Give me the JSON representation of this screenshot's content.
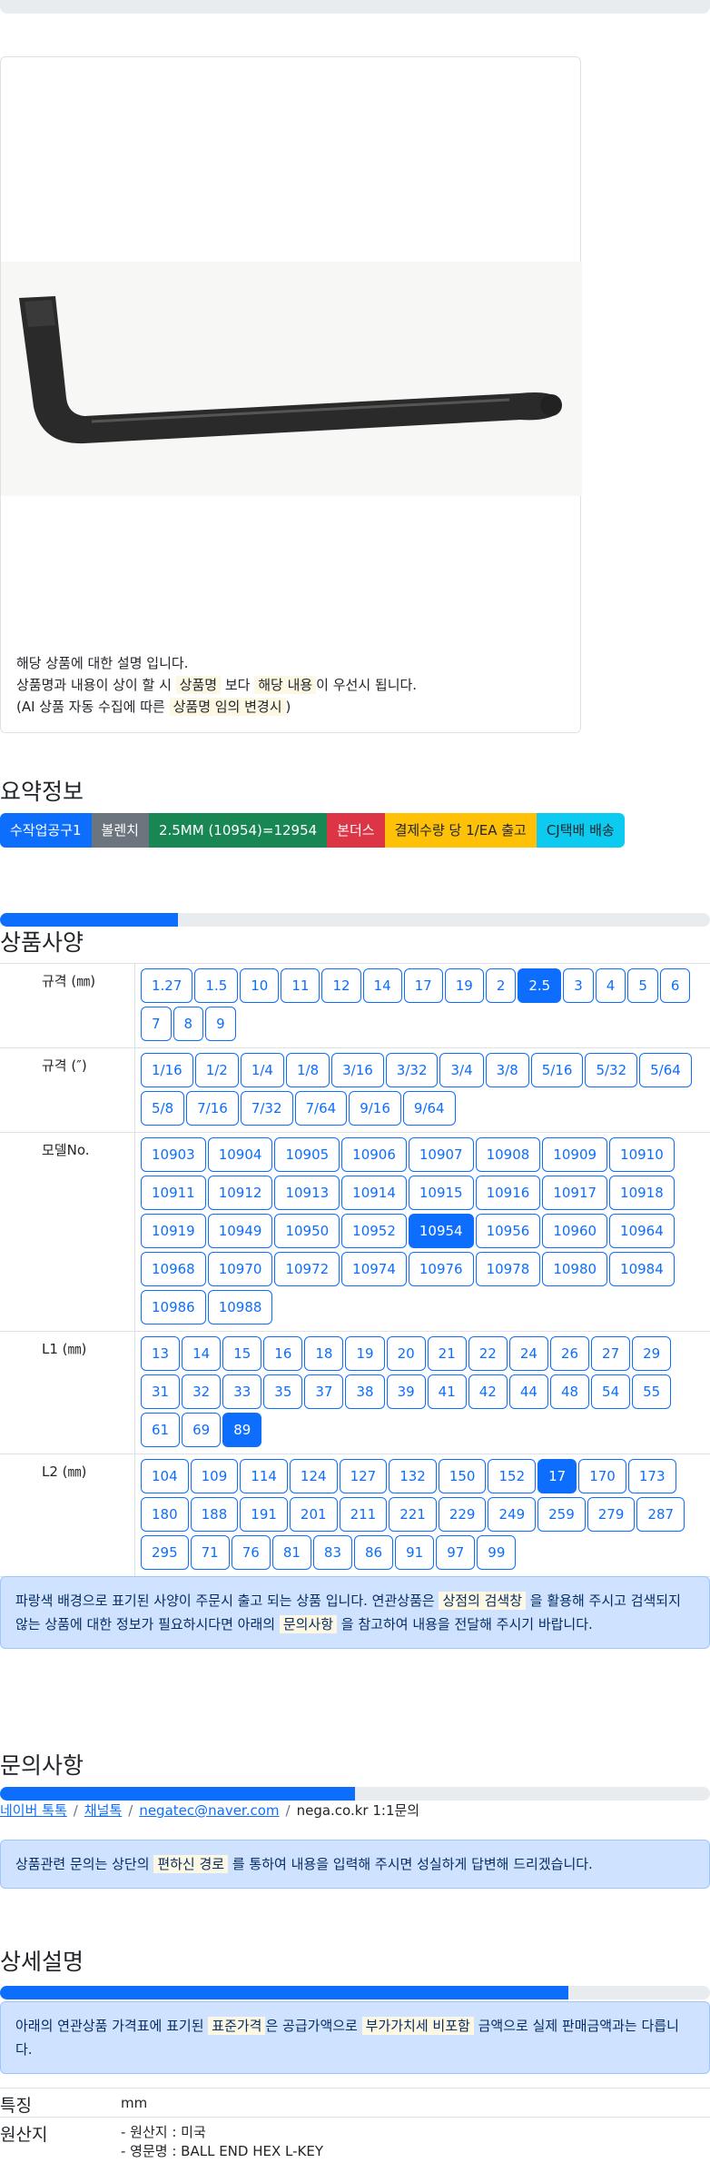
{
  "card": {
    "lines": [
      {
        "parts": [
          {
            "t": "해당 상품에 대한 설명 입니다."
          }
        ]
      },
      {
        "parts": [
          {
            "t": "상품명과 내용이 상이 할 시 "
          },
          {
            "t": "상품명",
            "m": true
          },
          {
            "t": " 보다 "
          },
          {
            "t": "해당 내용",
            "m": true
          },
          {
            "t": "이 우선시 됩니다."
          }
        ]
      },
      {
        "parts": [
          {
            "t": "(AI 상품 자동 수집에 따른 "
          },
          {
            "t": "상품명 임의 변경시",
            "m": true
          },
          {
            "t": ")"
          }
        ]
      }
    ]
  },
  "summary": {
    "title": "요약정보",
    "badges": [
      "수작업공구1",
      "볼렌치",
      "2.5MM (10954)=12954",
      "본더스",
      "결제수량 당 1/EA 출고",
      "CJ택배 배송"
    ]
  },
  "specs": {
    "title": "상품사양",
    "progress": 0.25,
    "rows": [
      {
        "label": "규격 (㎜)",
        "options": [
          "1.27",
          "1.5",
          "10",
          "11",
          "12",
          "14",
          "17",
          "19",
          "2",
          "2.5",
          "3",
          "4",
          "5",
          "6",
          "7",
          "8",
          "9"
        ],
        "selected": "2.5"
      },
      {
        "label": "규격 (″)",
        "options": [
          "1/16",
          "1/2",
          "1/4",
          "1/8",
          "3/16",
          "3/32",
          "3/4",
          "3/8",
          "5/16",
          "5/32",
          "5/64",
          "5/8",
          "7/16",
          "7/32",
          "7/64",
          "9/16",
          "9/64"
        ],
        "selected": null
      },
      {
        "label": "모델No.",
        "options": [
          "10903",
          "10904",
          "10905",
          "10906",
          "10907",
          "10908",
          "10909",
          "10910",
          "10911",
          "10912",
          "10913",
          "10914",
          "10915",
          "10916",
          "10917",
          "10918",
          "10919",
          "10949",
          "10950",
          "10952",
          "10954",
          "10956",
          "10960",
          "10964",
          "10968",
          "10970",
          "10972",
          "10974",
          "10976",
          "10978",
          "10980",
          "10984",
          "10986",
          "10988"
        ],
        "selected": "10954"
      },
      {
        "label": "L1 (㎜)",
        "options": [
          "13",
          "14",
          "15",
          "16",
          "18",
          "19",
          "20",
          "21",
          "22",
          "24",
          "26",
          "27",
          "29",
          "31",
          "32",
          "33",
          "35",
          "37",
          "38",
          "39",
          "41",
          "42",
          "44",
          "48",
          "54",
          "55",
          "61",
          "69",
          "89"
        ],
        "selected": "89"
      },
      {
        "label": "L2 (㎜)",
        "options": [
          "104",
          "109",
          "114",
          "124",
          "127",
          "132",
          "150",
          "152",
          "17",
          "170",
          "173",
          "180",
          "188",
          "191",
          "201",
          "211",
          "221",
          "229",
          "249",
          "259",
          "279",
          "287",
          "295",
          "71",
          "76",
          "81",
          "83",
          "86",
          "91",
          "97",
          "99"
        ],
        "selected": "17"
      }
    ],
    "notice": [
      {
        "t": "파랑색 배경으로 표기된 사양이 주문시 출고 되는 상품 입니다. 연관상품은 "
      },
      {
        "t": "상점의 검색창",
        "m": true
      },
      {
        "t": " 을 활용해 주시고 검색되지 않는 상품에 대한 정보가 필요하시다면 아래의 "
      },
      {
        "t": "문의사항",
        "m": true
      },
      {
        "t": " 을 참고하여 내용을 전달해 주시기 바랍니다."
      }
    ]
  },
  "inquiry": {
    "title": "문의사항",
    "progress": 0.5,
    "links": [
      "네이버 톡톡",
      "채널톡",
      "negatec@naver.com"
    ],
    "tail": "nega.co.kr 1:1문의",
    "notice": [
      {
        "t": "상품관련 문의는 상단의 "
      },
      {
        "t": "편하신 경로",
        "m": true
      },
      {
        "t": " 를 통하여 내용을 입력해 주시면 성실하게 답변해 드리겠습니다."
      }
    ]
  },
  "detail": {
    "title": "상세설명",
    "progress": 0.8,
    "notice": [
      {
        "t": "아래의 연관상품 가격표에 표기된 "
      },
      {
        "t": "표준가격",
        "m": true
      },
      {
        "t": "은 공급가액으로 "
      },
      {
        "t": "부가가치세 비포함",
        "m": true
      },
      {
        "t": " 금액으로 실제 판매금액과는 다릅니다."
      }
    ],
    "features": [
      {
        "key": "특징",
        "values": [
          "mm"
        ]
      },
      {
        "key": "원산지",
        "values": [
          "- 원산지 : 미국",
          "- 영문명 : BALL END HEX L-KEY"
        ]
      }
    ]
  },
  "colors": {
    "primary": "#0d6efd",
    "highlight": "#fcf8e3",
    "alert_bg": "#cfe2ff"
  }
}
